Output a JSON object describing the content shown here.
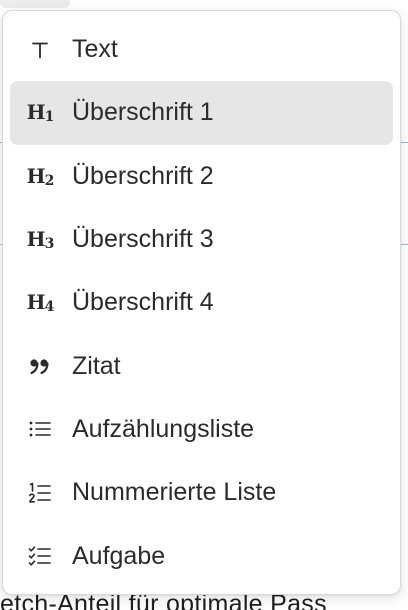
{
  "menu": {
    "items": [
      {
        "label": "Text",
        "icon": "text-icon",
        "active": false
      },
      {
        "label": "Überschrift 1",
        "icon": "heading-1-icon",
        "active": true
      },
      {
        "label": "Überschrift 2",
        "icon": "heading-2-icon",
        "active": false
      },
      {
        "label": "Überschrift 3",
        "icon": "heading-3-icon",
        "active": false
      },
      {
        "label": "Überschrift 4",
        "icon": "heading-4-icon",
        "active": false
      },
      {
        "label": "Zitat",
        "icon": "quote-icon",
        "active": false
      },
      {
        "label": "Aufzählungsliste",
        "icon": "bullet-list-icon",
        "active": false
      },
      {
        "label": "Nummerierte Liste",
        "icon": "numbered-list-icon",
        "active": false
      },
      {
        "label": "Aufgabe",
        "icon": "task-list-icon",
        "active": false
      }
    ],
    "active_bg": "#e6e6e6"
  },
  "background": {
    "bottom_text": "etch-Anteil für optimale Pass"
  }
}
